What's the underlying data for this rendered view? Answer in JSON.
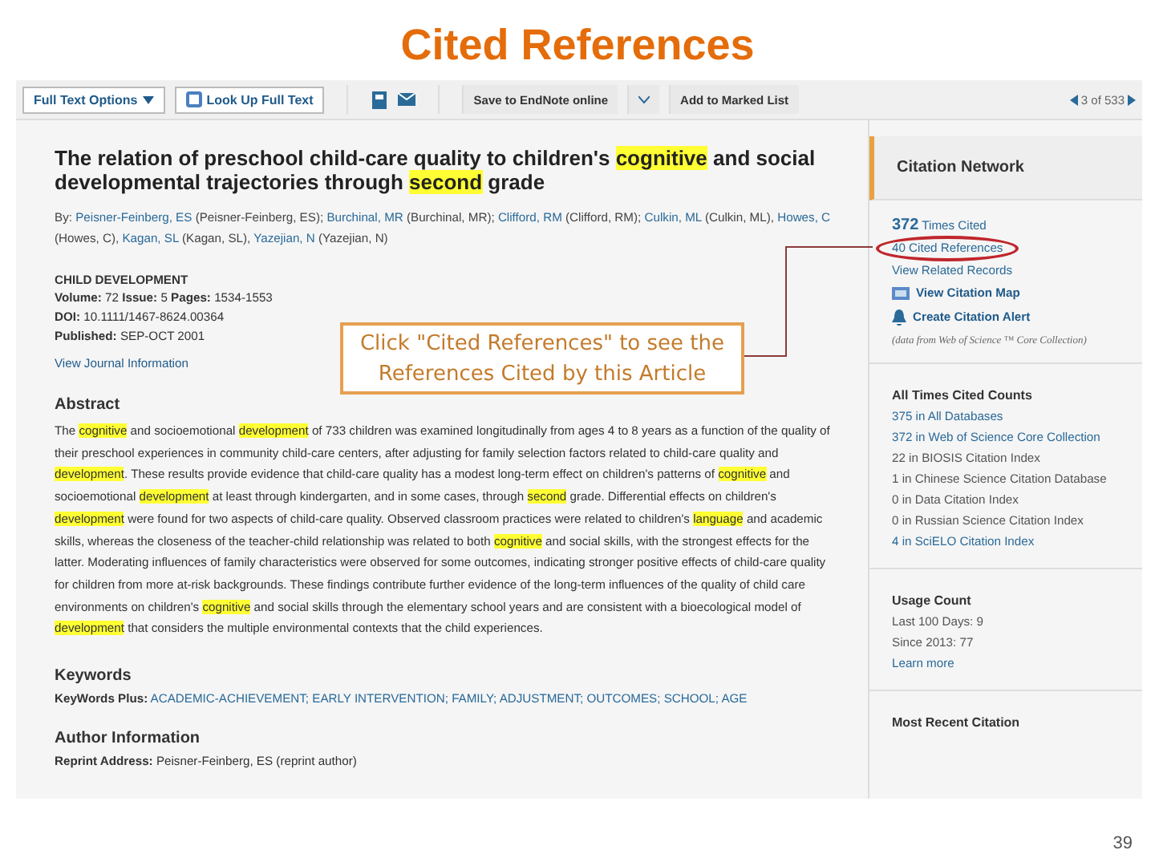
{
  "slide": {
    "title": "Cited References",
    "page_number": "39"
  },
  "toolbar": {
    "full_text_options": "Full Text Options",
    "look_up": "Look Up Full Text",
    "save": "Save to EndNote online",
    "add": "Add to Marked List",
    "pager": "3 of 533"
  },
  "record": {
    "title": [
      {
        "text": "The relation of preschool child-care quality to children's ",
        "highlight": false
      },
      {
        "text": "cognitive",
        "highlight": true
      },
      {
        "text": " and social developmental trajectories through ",
        "highlight": false
      },
      {
        "text": "second",
        "highlight": true
      },
      {
        "text": " grade",
        "highlight": false
      }
    ],
    "authors": [
      {
        "text": "By: ",
        "link": false
      },
      {
        "text": "Peisner-Feinberg, ES",
        "link": true
      },
      {
        "text": " (Peisner-Feinberg, ES); ",
        "link": false
      },
      {
        "text": "Burchinal, MR",
        "link": true
      },
      {
        "text": " (Burchinal, MR); ",
        "link": false
      },
      {
        "text": "Clifford, RM",
        "link": true
      },
      {
        "text": " (Clifford, RM); ",
        "link": false
      },
      {
        "text": "Culkin, ML",
        "link": true
      },
      {
        "text": " (Culkin, ML), ",
        "link": false
      },
      {
        "text": "Howes, C",
        "link": true
      },
      {
        "text": " (Howes, C), ",
        "link": false
      },
      {
        "text": "Kagan, SL",
        "link": true
      },
      {
        "text": " (Kagan, SL), ",
        "link": false
      },
      {
        "text": "Yazejian, N",
        "link": true
      },
      {
        "text": " (Yazejian, N)",
        "link": false
      }
    ],
    "journal": "CHILD DEVELOPMENT",
    "meta": [
      [
        {
          "label": "Volume:",
          "value": "72"
        },
        {
          "label": "Issue:",
          "value": "5"
        },
        {
          "label": "Pages:",
          "value": "1534-1553"
        }
      ],
      [
        {
          "label": "DOI:",
          "value": "10.1111/1467-8624.00364"
        }
      ],
      [
        {
          "label": "Published:",
          "value": "SEP-OCT 2001"
        }
      ]
    ],
    "journal_link": "View Journal Information",
    "abstract_heading": "Abstract",
    "abstract": [
      {
        "text": "The ",
        "highlight": false
      },
      {
        "text": "cognitive",
        "highlight": true
      },
      {
        "text": " and socioemotional ",
        "highlight": false
      },
      {
        "text": "development",
        "highlight": true
      },
      {
        "text": " of 733 children was examined longitudinally from ages 4 to 8 years as a function of the quality of their preschool experiences in community child-care centers, after adjusting for family selection factors related to child-care quality and ",
        "highlight": false
      },
      {
        "text": "development",
        "highlight": true
      },
      {
        "text": ". These results provide evidence that child-care quality has a modest long-term effect on children's patterns of ",
        "highlight": false
      },
      {
        "text": "cognitive",
        "highlight": true
      },
      {
        "text": " and socioemotional ",
        "highlight": false
      },
      {
        "text": "development",
        "highlight": true
      },
      {
        "text": " at least through kindergarten, and in some cases, through ",
        "highlight": false
      },
      {
        "text": "second",
        "highlight": true
      },
      {
        "text": " grade. Differential effects on children's ",
        "highlight": false
      },
      {
        "text": "development",
        "highlight": true
      },
      {
        "text": " were found for two aspects of child-care quality. Observed classroom practices were related to children's ",
        "highlight": false
      },
      {
        "text": "language",
        "highlight": true
      },
      {
        "text": " and academic skills, whereas the closeness of the teacher-child relationship was related to both ",
        "highlight": false
      },
      {
        "text": "cognitive",
        "highlight": true
      },
      {
        "text": " and social skills, with the strongest effects for the latter. Moderating influences of family characteristics were observed for some outcomes, indicating stronger positive effects of child-care quality for children from more at-risk backgrounds. These findings contribute further evidence of the long-term influences of the quality of child care environments on children's ",
        "highlight": false
      },
      {
        "text": "cognitive",
        "highlight": true
      },
      {
        "text": " and social skills through the elementary school years and are consistent with a bioecological model of ",
        "highlight": false
      },
      {
        "text": "development",
        "highlight": true
      },
      {
        "text": " that considers the multiple environmental contexts that the child experiences.",
        "highlight": false
      }
    ],
    "keywords_heading": "Keywords",
    "keywords_label": "KeyWords Plus:",
    "keywords": "ACADEMIC-ACHIEVEMENT; EARLY INTERVENTION; FAMILY; ADJUSTMENT; OUTCOMES; SCHOOL; AGE",
    "author_info_heading": "Author Information",
    "reprint_label": "Reprint Address:",
    "reprint_value": "Peisner-Feinberg, ES (reprint author)"
  },
  "sidebar": {
    "network_heading": "Citation Network",
    "times_cited_count": "372",
    "times_cited_label": "Times Cited",
    "cited_references": "40 Cited References",
    "related": "View Related Records",
    "citation_map": "View Citation Map",
    "citation_alert": "Create Citation Alert",
    "data_note": "(data from Web of Science ™ Core Collection)",
    "counts_heading": "All Times Cited Counts",
    "counts": [
      {
        "text": "375 in All Databases",
        "link": true
      },
      {
        "text": "372 in Web of Science Core Collection",
        "link": true
      },
      {
        "text": "22 in BIOSIS Citation Index",
        "link": false
      },
      {
        "text": "1 in Chinese Science Citation Database",
        "link": false
      },
      {
        "text": "0 in Data Citation Index",
        "link": false
      },
      {
        "text": "0 in Russian Science Citation Index",
        "link": false
      },
      {
        "text": "4 in SciELO Citation Index",
        "link": true
      }
    ],
    "usage_heading": "Usage Count",
    "usage": [
      "Last 100 Days: 9",
      "Since 2013: 77"
    ],
    "learn_more": "Learn more",
    "recent_heading": "Most Recent Citation"
  },
  "callout": {
    "text": "Click \"Cited References\" to see the References Cited by this Article"
  }
}
